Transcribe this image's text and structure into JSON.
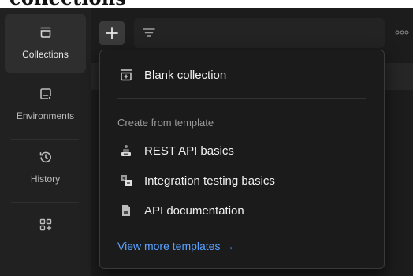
{
  "heading": {
    "clipped_text": "collections"
  },
  "sidebar": {
    "items": [
      {
        "label": "Collections",
        "icon": "collections-icon",
        "active": true
      },
      {
        "label": "Environments",
        "icon": "environments-icon",
        "active": false
      },
      {
        "label": "History",
        "icon": "history-icon",
        "active": false
      },
      {
        "label": "",
        "icon": "add-widget-icon",
        "active": false
      }
    ]
  },
  "toolbar": {
    "add_icon": "plus-icon",
    "filter_icon": "filter-icon",
    "more_icon": "more-dots-icon"
  },
  "menu": {
    "blank_collection": "Blank collection",
    "section_label": "Create from template",
    "templates": [
      {
        "label": "REST API basics",
        "icon": "rest-api-icon"
      },
      {
        "label": "Integration testing basics",
        "icon": "integration-testing-icon"
      },
      {
        "label": "API documentation",
        "icon": "api-documentation-icon"
      }
    ],
    "view_more": "View more templates →"
  },
  "colors": {
    "link": "#5aa2ff",
    "active_rail": "#2e2e2e",
    "menu_bg": "#1b1b1b"
  }
}
